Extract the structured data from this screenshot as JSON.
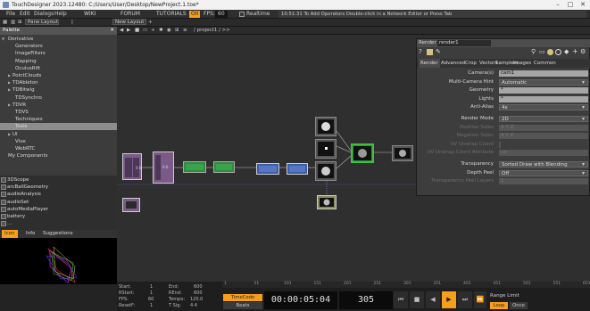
{
  "window": {
    "title": "TouchDesigner 2023.12480: C:/Users/User/Desktop/NewProject.1.toe*",
    "min": "–",
    "max": "□",
    "close": "✕"
  },
  "menubar": {
    "items": [
      "File",
      "Edit",
      "Dialogs",
      "Help"
    ],
    "wiki": "WIKI",
    "forum": "FORUM",
    "tutorials": "TUTORIALS",
    "oii": "OII",
    "fps": "FPS:",
    "fps_value": "60",
    "realtime": "Realtime",
    "status": "10:51:31 To Add Operators Double-click in a Network Editor or Press Tab"
  },
  "toolbar": {
    "pane_layout": "Pane Layout",
    "new_layout": "New Layout",
    "plus": "+"
  },
  "netbar": {
    "path": "/ project1 / >>"
  },
  "palette": {
    "header": "Palette",
    "items": [
      {
        "label": "Derivative",
        "indent": 0,
        "arrow": "▼"
      },
      {
        "label": "Generators",
        "indent": 2
      },
      {
        "label": "ImageFilters",
        "indent": 2
      },
      {
        "label": "Mapping",
        "indent": 2
      },
      {
        "label": "OculusRift",
        "indent": 2
      },
      {
        "label": "PointClouds",
        "indent": 1,
        "arrow": "▶"
      },
      {
        "label": "TDAbleton",
        "indent": 1,
        "arrow": "▶"
      },
      {
        "label": "TDBitwig",
        "indent": 1,
        "arrow": "▶"
      },
      {
        "label": "TDSynchro",
        "indent": 2
      },
      {
        "label": "TDVR",
        "indent": 1,
        "arrow": "▶"
      },
      {
        "label": "TDVS",
        "indent": 2
      },
      {
        "label": "Techniques",
        "indent": 2
      },
      {
        "label": "Tools",
        "indent": 2,
        "selected": true
      },
      {
        "label": "UI",
        "indent": 1,
        "arrow": "▶"
      },
      {
        "label": "Vive",
        "indent": 2
      },
      {
        "label": "WebRTC",
        "indent": 2
      },
      {
        "label": "My Components",
        "indent": 0
      }
    ]
  },
  "oplist": {
    "items": [
      "3DScope",
      "arcBallGeometry",
      "audioAnalysis",
      "audioSet",
      "autoMediaPlayer",
      "battery",
      "..."
    ]
  },
  "viewtabs": {
    "icon": "Icon",
    "info": "Info",
    "suggestions": "Suggestions"
  },
  "params": {
    "header_type": "Render",
    "header_name": "render1",
    "tabs": [
      "Render",
      "Advanced",
      "Crop",
      "Vectors",
      "Samplers",
      "Images",
      "Common"
    ],
    "rows": [
      {
        "label": "Camera(s)",
        "value": "cam1",
        "kind": "field"
      },
      {
        "label": "Multi-Camera Hint",
        "value": "Automatic",
        "kind": "drop"
      },
      {
        "label": "Geometry",
        "value": "*",
        "kind": "field"
      },
      {
        "label": "Lights",
        "value": "*",
        "kind": "field"
      },
      {
        "label": "Anti-Alias",
        "value": "4x",
        "kind": "drop"
      },
      {
        "label": "",
        "value": "",
        "kind": "gap"
      },
      {
        "label": "Render Mode",
        "value": "2D",
        "kind": "drop"
      },
      {
        "label": "Positive Sides",
        "value": "X   Y   Z",
        "kind": "dim"
      },
      {
        "label": "Negative Sides",
        "value": "X   Y   Z",
        "kind": "dim"
      },
      {
        "label": "UV Unwrap Coord",
        "value": "",
        "kind": "dim"
      },
      {
        "label": "UV Unwrap Coord Attribute",
        "value": "uv",
        "kind": "dim"
      },
      {
        "label": "",
        "value": "",
        "kind": "gap"
      },
      {
        "label": "Transparency",
        "value": "Sorted Draw with Blending",
        "kind": "drop"
      },
      {
        "label": "Depth Peel",
        "value": "Off",
        "kind": "drop"
      },
      {
        "label": "Transparency Peel Layers",
        "value": "1",
        "kind": "dim"
      }
    ]
  },
  "timeline": {
    "ruler": [
      "1",
      "51",
      "101",
      "151",
      "201",
      "251",
      "301",
      "351",
      "401",
      "451",
      "501",
      "551",
      "601"
    ],
    "start_l": "Start:",
    "start_v": "1",
    "rstart_l": "RStart:",
    "rstart_v": "1",
    "fps_l": "FPS:",
    "fps_v": "60",
    "reset_l": "ResetF:",
    "reset_v": "1",
    "end_l": "End:",
    "end_v": "600",
    "rend_l": "REnd:",
    "rend_v": "600",
    "tempo_l": "Tempo:",
    "tempo_v": "120.0",
    "tsig_l": "T Sig:",
    "tsig_v": "4   4",
    "timecode": "TimeCode",
    "beats": "Beats",
    "time": "00:00:05:04",
    "frame": "305",
    "range_limit": "Range Limit",
    "loop": "Loop",
    "once": "Once",
    "ctrl": {
      "start": "⏮",
      "stop": "■",
      "back": "◀",
      "play": "▶",
      "fwd": "⏭",
      "next": "⏩"
    }
  },
  "colors": {
    "accent": "#f79e1b",
    "node_green": "#2e8b3e",
    "node_purple": "#7b5a87"
  }
}
